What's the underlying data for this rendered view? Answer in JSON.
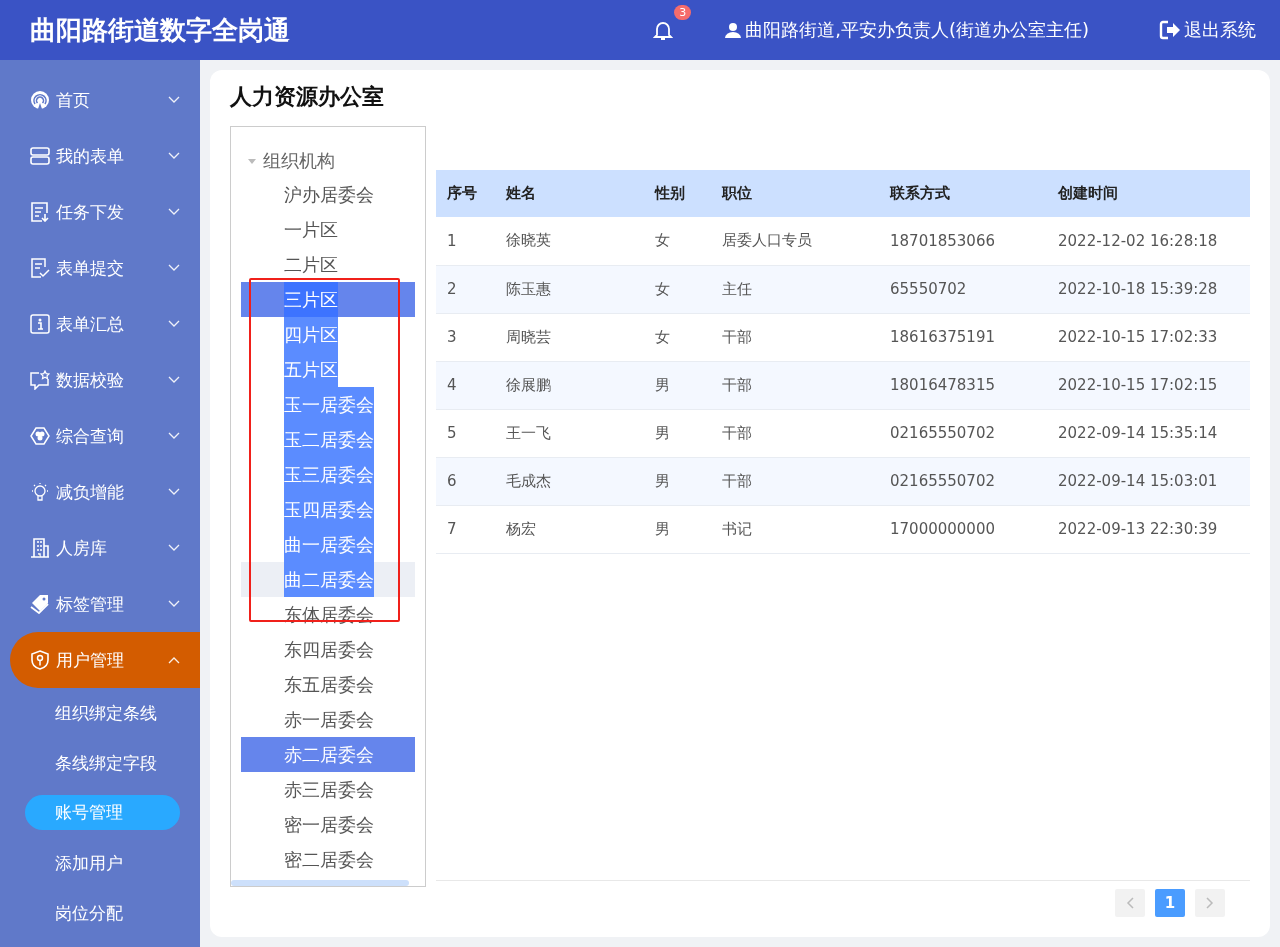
{
  "header": {
    "title": "曲阳路街道数字全岗通",
    "notification_count": "3",
    "user": "曲阳路街道,平安办负责人(街道办公室主任)",
    "logout": "退出系统"
  },
  "sidebar": {
    "items": [
      {
        "label": "首页",
        "expanded": false,
        "selected": false
      },
      {
        "label": "我的表单",
        "expanded": false,
        "selected": false
      },
      {
        "label": "任务下发",
        "expanded": false,
        "selected": false
      },
      {
        "label": "表单提交",
        "expanded": false,
        "selected": false
      },
      {
        "label": "表单汇总",
        "expanded": false,
        "selected": false
      },
      {
        "label": "数据校验",
        "expanded": false,
        "selected": false
      },
      {
        "label": "综合查询",
        "expanded": false,
        "selected": false
      },
      {
        "label": "减负增能",
        "expanded": false,
        "selected": false
      },
      {
        "label": "人房库",
        "expanded": false,
        "selected": false
      },
      {
        "label": "标签管理",
        "expanded": false,
        "selected": false
      },
      {
        "label": "用户管理",
        "expanded": true,
        "selected": true,
        "children": [
          {
            "label": "组织绑定条线",
            "selected": false
          },
          {
            "label": "条线绑定字段",
            "selected": false
          },
          {
            "label": "账号管理",
            "selected": true
          },
          {
            "label": "添加用户",
            "selected": false
          },
          {
            "label": "岗位分配",
            "selected": false
          }
        ]
      }
    ]
  },
  "page": {
    "title": "人力资源办公室"
  },
  "tree": {
    "label": "组织机构",
    "expanded": true,
    "annotation_frame": true,
    "children": [
      {
        "label": "沪办居委会",
        "selected": false,
        "hovered": false,
        "text_selected": false
      },
      {
        "label": "一片区",
        "selected": false,
        "hovered": false,
        "text_selected": false
      },
      {
        "label": "二片区",
        "selected": false,
        "hovered": false,
        "text_selected": false
      },
      {
        "label": "三片区",
        "selected": true,
        "hovered": false,
        "text_selected": true
      },
      {
        "label": "四片区",
        "selected": false,
        "hovered": false,
        "text_selected": true
      },
      {
        "label": "五片区",
        "selected": false,
        "hovered": false,
        "text_selected": true
      },
      {
        "label": "玉一居委会",
        "selected": false,
        "hovered": false,
        "text_selected": true
      },
      {
        "label": "玉二居委会",
        "selected": false,
        "hovered": false,
        "text_selected": true
      },
      {
        "label": "玉三居委会",
        "selected": false,
        "hovered": false,
        "text_selected": true
      },
      {
        "label": "玉四居委会",
        "selected": false,
        "hovered": false,
        "text_selected": true
      },
      {
        "label": "曲一居委会",
        "selected": false,
        "hovered": false,
        "text_selected": true
      },
      {
        "label": "曲二居委会",
        "selected": false,
        "hovered": true,
        "text_selected": true
      },
      {
        "label": "东体居委会",
        "selected": false,
        "hovered": false,
        "text_selected": false
      },
      {
        "label": "东四居委会",
        "selected": false,
        "hovered": false,
        "text_selected": false
      },
      {
        "label": "东五居委会",
        "selected": false,
        "hovered": false,
        "text_selected": false
      },
      {
        "label": "赤一居委会",
        "selected": false,
        "hovered": false,
        "text_selected": false
      },
      {
        "label": "赤二居委会",
        "selected": true,
        "hovered": false,
        "text_selected": false
      },
      {
        "label": "赤三居委会",
        "selected": false,
        "hovered": false,
        "text_selected": false
      },
      {
        "label": "密一居委会",
        "selected": false,
        "hovered": false,
        "text_selected": false
      },
      {
        "label": "密二居委会",
        "selected": false,
        "hovered": false,
        "text_selected": false
      }
    ]
  },
  "table": {
    "columns": [
      "序号",
      "姓名",
      "性别",
      "职位",
      "联系方式",
      "创建时间"
    ],
    "rows": [
      [
        "1",
        "徐晓英",
        "女",
        "居委人口专员",
        "18701853066",
        "2022-12-02 16:28:18"
      ],
      [
        "2",
        "陈玉惠",
        "女",
        "主任",
        "65550702",
        "2022-10-18 15:39:28"
      ],
      [
        "3",
        "周晓芸",
        "女",
        "干部",
        "18616375191",
        "2022-10-15 17:02:33"
      ],
      [
        "4",
        "徐展鹏",
        "男",
        "干部",
        "18016478315",
        "2022-10-15 17:02:15"
      ],
      [
        "5",
        "王一飞",
        "男",
        "干部",
        "02165550702",
        "2022-09-14 15:35:14"
      ],
      [
        "6",
        "毛成杰",
        "男",
        "干部",
        "02165550702",
        "2022-09-14 15:03:01"
      ],
      [
        "7",
        "杨宏",
        "男",
        "书记",
        "17000000000",
        "2022-09-13 22:30:39"
      ]
    ]
  },
  "pagination": {
    "prev_disabled": true,
    "next_disabled": true,
    "pages": [
      {
        "label": "1",
        "selected": true
      }
    ]
  }
}
